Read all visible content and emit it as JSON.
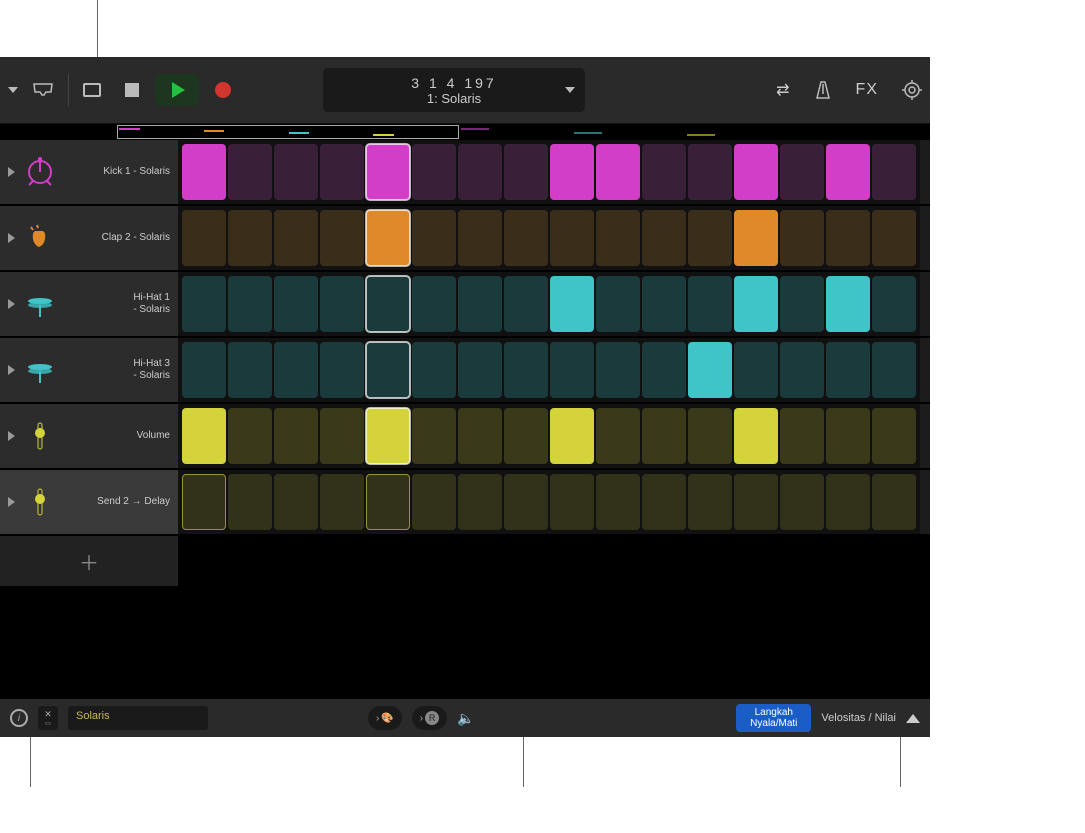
{
  "toolbar": {
    "lcd_position": "3  1  4  197",
    "lcd_pattern": "1: Solaris",
    "fx_label": "FX"
  },
  "playhead_step": 4,
  "accent_colors": {
    "kick": "#d23ec7",
    "clap": "#e0892a",
    "hihat": "#3fc4c8",
    "volume": "#d4d43a",
    "send": "#9a9232"
  },
  "tracks": [
    {
      "name": "Kick 1 - Solaris",
      "icon": "kick-drum",
      "icon_color": "#d23ec7",
      "active_color": "#d23ec7",
      "dim_color": "#3a1f38",
      "steps": [
        1,
        0,
        0,
        0,
        1,
        0,
        0,
        0,
        1,
        1,
        0,
        0,
        1,
        0,
        1,
        0
      ]
    },
    {
      "name": "Clap 2 - Solaris",
      "icon": "clap",
      "icon_color": "#e0892a",
      "active_color": "#e0892a",
      "dim_color": "#3a2e1a",
      "steps": [
        0,
        0,
        0,
        0,
        1,
        0,
        0,
        0,
        0,
        0,
        0,
        0,
        1,
        0,
        0,
        0
      ]
    },
    {
      "name": "Hi-Hat 1\n- Solaris",
      "icon": "hihat",
      "icon_color": "#3fc4c8",
      "active_color": "#3fc4c8",
      "dim_color": "#1a3a3c",
      "steps": [
        0,
        0,
        0,
        0,
        0,
        0,
        0,
        0,
        1,
        0,
        0,
        0,
        1,
        0,
        1,
        0
      ]
    },
    {
      "name": "Hi-Hat 3\n- Solaris",
      "icon": "hihat",
      "icon_color": "#3fc4c8",
      "active_color": "#3fc4c8",
      "dim_color": "#1a3a3c",
      "steps": [
        0,
        0,
        0,
        0,
        0,
        0,
        0,
        0,
        0,
        0,
        0,
        1,
        0,
        0,
        0,
        0
      ]
    },
    {
      "name": "Volume",
      "icon": "automation",
      "icon_color": "#d4d43a",
      "active_color": "#d4d43a",
      "dim_color": "#3a3a1a",
      "steps": [
        1,
        0,
        0,
        0,
        1,
        0,
        0,
        0,
        1,
        0,
        0,
        0,
        1,
        0,
        0,
        0
      ]
    },
    {
      "name": "Send 2 → Delay",
      "icon": "automation",
      "icon_color": "#d4d43a",
      "active_color": "#9a9232",
      "dim_color": "#32321a",
      "selected": true,
      "steps": [
        0,
        0,
        0,
        0,
        0,
        0,
        0,
        0,
        0,
        0,
        0,
        0,
        0,
        0,
        0,
        0
      ],
      "outline_steps": [
        0,
        4
      ]
    }
  ],
  "bottom_bar": {
    "sound_name": "Solaris",
    "step_mode": "Langkah\nNyala/Mati",
    "velocity_label": "Velositas / Nilai"
  }
}
